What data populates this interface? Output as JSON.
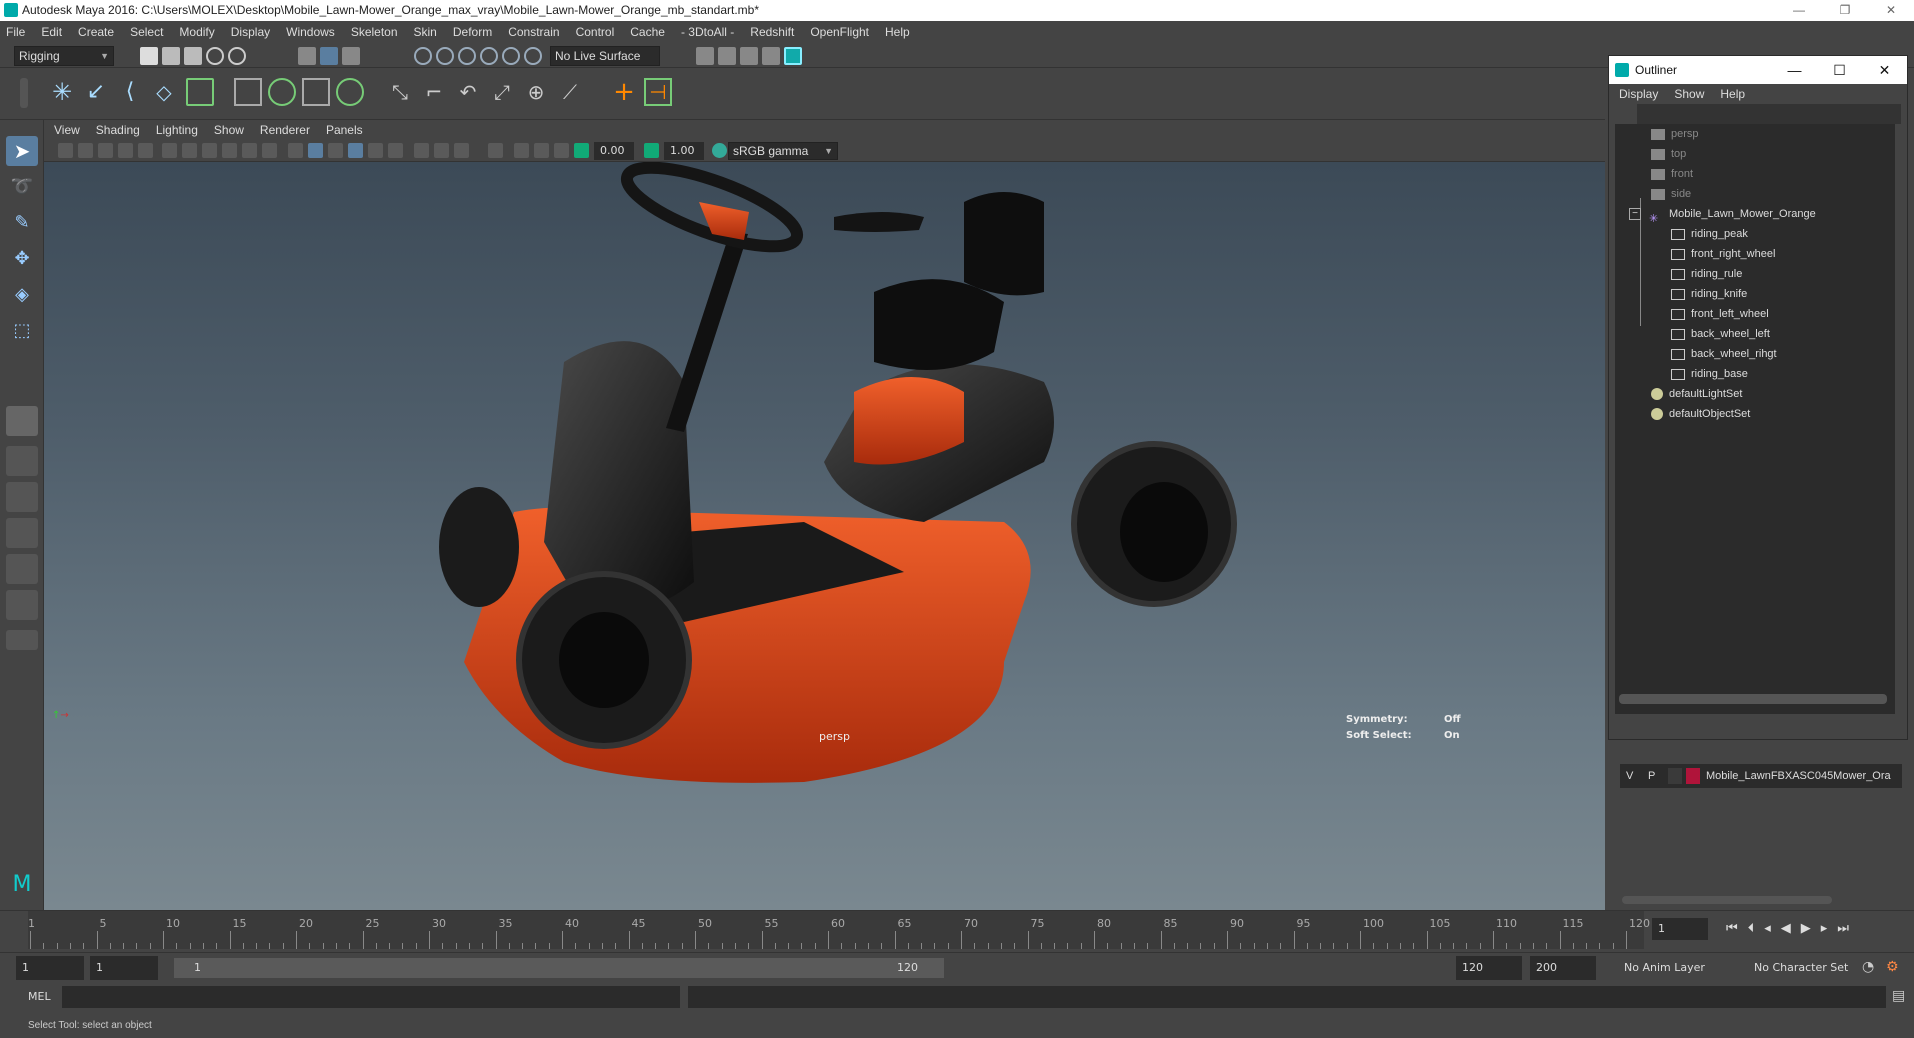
{
  "window": {
    "title": "Autodesk Maya 2016: C:\\Users\\MOLEX\\Desktop\\Mobile_Lawn-Mower_Orange_max_vray\\Mobile_Lawn-Mower_Orange_mb_standart.mb*",
    "controls": [
      "—",
      "❐",
      "✕"
    ]
  },
  "menubar": [
    "File",
    "Edit",
    "Create",
    "Select",
    "Modify",
    "Display",
    "Windows",
    "Skeleton",
    "Skin",
    "Deform",
    "Constrain",
    "Control",
    "Cache",
    "- 3DtoAll -",
    "Redshift",
    "OpenFlight",
    "Help"
  ],
  "statusline": {
    "mode": "Rigging",
    "live_surface": "No Live Surface"
  },
  "panel": {
    "menu": [
      "View",
      "Shading",
      "Lighting",
      "Show",
      "Renderer",
      "Panels"
    ],
    "near_value": "0.00",
    "far_value": "1.00",
    "color_space": "sRGB gamma"
  },
  "viewport": {
    "camera": "persp",
    "symmetry_label": "Symmetry:",
    "symmetry_value": "Off",
    "soft_select_label": "Soft Select:",
    "soft_select_value": "On",
    "colors": {
      "orange": "#d9431a",
      "black": "#1a1a1a",
      "bg_top": "#3c4a57",
      "bg_bottom": "#7a8890"
    }
  },
  "outliner": {
    "title": "Outliner",
    "menu": [
      "Display",
      "Show",
      "Help"
    ],
    "items": [
      {
        "label": "persp",
        "icon": "camera-icon",
        "dim": true
      },
      {
        "label": "top",
        "icon": "camera-icon",
        "dim": true
      },
      {
        "label": "front",
        "icon": "camera-icon",
        "dim": true
      },
      {
        "label": "side",
        "icon": "camera-icon",
        "dim": true
      },
      {
        "label": "Mobile_Lawn_Mower_Orange",
        "icon": "joint-icon",
        "dim": false
      },
      {
        "label": "riding_peak",
        "icon": "mesh-icon",
        "dim": false
      },
      {
        "label": "front_right_wheel",
        "icon": "mesh-icon",
        "dim": false
      },
      {
        "label": "riding_rule",
        "icon": "mesh-icon",
        "dim": false
      },
      {
        "label": "riding_knife",
        "icon": "mesh-icon",
        "dim": false
      },
      {
        "label": "front_left_wheel",
        "icon": "mesh-icon",
        "dim": false
      },
      {
        "label": "back_wheel_left",
        "icon": "mesh-icon",
        "dim": false
      },
      {
        "label": "back_wheel_rihgt",
        "icon": "mesh-icon",
        "dim": false
      },
      {
        "label": "riding_base",
        "icon": "mesh-icon",
        "dim": false
      },
      {
        "label": "defaultLightSet",
        "icon": "set-icon",
        "dim": false
      },
      {
        "label": "defaultObjectSet",
        "icon": "set-icon",
        "dim": false
      }
    ]
  },
  "layers": {
    "v": "V",
    "p": "P",
    "name": "Mobile_LawnFBXASC045Mower_Ora",
    "color": "#b0143a"
  },
  "timeline": {
    "labels": [
      "5",
      "10",
      "15",
      "20",
      "25",
      "30",
      "35",
      "40",
      "45",
      "50",
      "55",
      "60",
      "65",
      "70",
      "75",
      "80",
      "85",
      "90",
      "95",
      "100",
      "105",
      "110",
      "115",
      "120"
    ],
    "start_label": "1",
    "current_frame": "1"
  },
  "range": {
    "start": "1",
    "inner_start": "1",
    "slider_start": "1",
    "slider_end": "120",
    "end": "120",
    "total_end": "200",
    "anim_layer": "No Anim Layer",
    "char_set": "No Character Set"
  },
  "cmdline": {
    "lang": "MEL"
  },
  "helpline": {
    "text": "Select Tool: select an object"
  }
}
